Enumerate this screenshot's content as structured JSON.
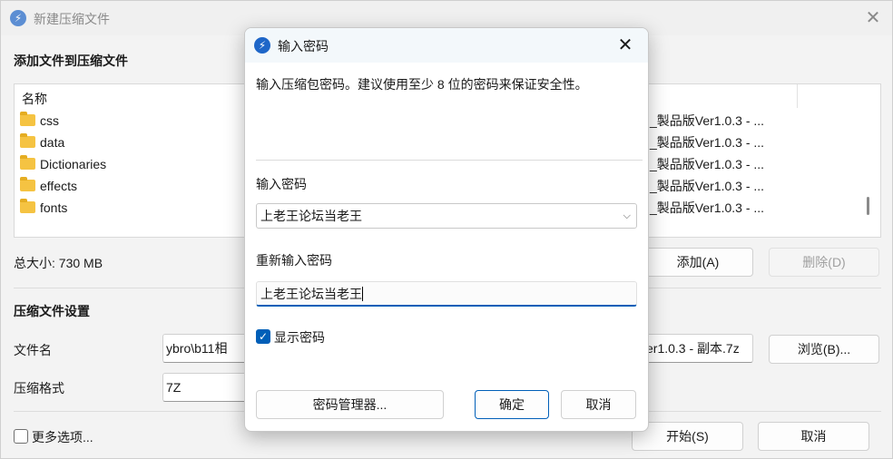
{
  "main": {
    "title": "新建压缩文件",
    "add_section_title": "添加文件到压缩文件",
    "list_header": "名称",
    "files": [
      "css",
      "data",
      "Dictionaries",
      "effects",
      "fonts"
    ],
    "right_entries": [
      "_製品版Ver1.0.3 - ...",
      "_製品版Ver1.0.3 - ...",
      "_製品版Ver1.0.3 - ...",
      "_製品版Ver1.0.3 - ...",
      "_製品版Ver1.0.3 - ..."
    ],
    "total_size": "总大小: 730 MB",
    "add_button": "添加(A)",
    "delete_button": "删除(D)",
    "settings_title": "压缩文件设置",
    "filename_label": "文件名",
    "filename_left": "ybro\\b11相",
    "filename_right": "er1.0.3 - 副本.7z",
    "browse_button": "浏览(B)...",
    "format_label": "压缩格式",
    "format_value": "7Z",
    "more_options": "更多选项...",
    "start_button": "开始(S)",
    "cancel_button": "取消"
  },
  "dialog": {
    "title": "输入密码",
    "hint": "输入压缩包密码。建议使用至少 8 位的密码来保证安全性。",
    "password_label": "输入密码",
    "password_value": "上老王论坛当老王",
    "reenter_label": "重新输入密码",
    "reenter_value": "上老王论坛当老王",
    "show_password_label": "显示密码",
    "show_password_checked": true,
    "password_manager_button": "密码管理器...",
    "ok_button": "确定",
    "cancel_button": "取消"
  },
  "icons": {
    "app": "lightning-icon",
    "close": "close-icon",
    "folder": "folder-icon",
    "dropdown": "chevron-down-icon",
    "check": "checkmark-icon"
  },
  "colors": {
    "accent": "#005fb8",
    "app_icon": "#1e66c8",
    "folder": "#f5c342"
  }
}
